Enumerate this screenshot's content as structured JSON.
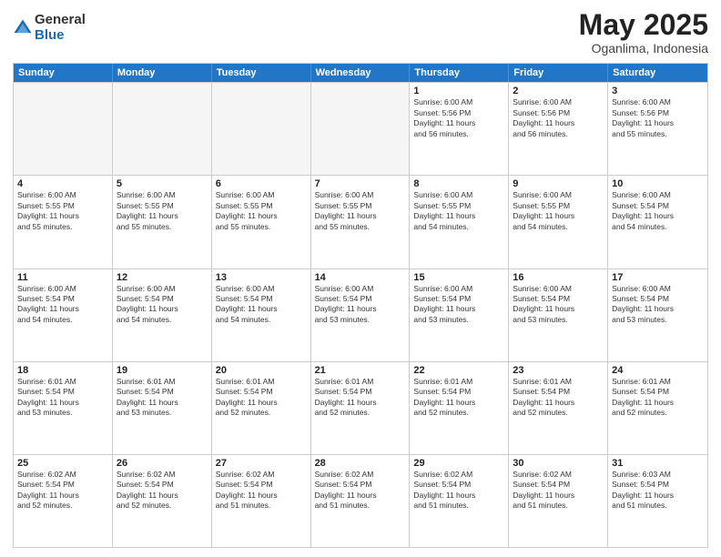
{
  "logo": {
    "general": "General",
    "blue": "Blue"
  },
  "title": "May 2025",
  "location": "Oganlima, Indonesia",
  "header_days": [
    "Sunday",
    "Monday",
    "Tuesday",
    "Wednesday",
    "Thursday",
    "Friday",
    "Saturday"
  ],
  "rows": [
    [
      {
        "day": "",
        "text": "",
        "empty": true
      },
      {
        "day": "",
        "text": "",
        "empty": true
      },
      {
        "day": "",
        "text": "",
        "empty": true
      },
      {
        "day": "",
        "text": "",
        "empty": true
      },
      {
        "day": "1",
        "text": "Sunrise: 6:00 AM\nSunset: 5:56 PM\nDaylight: 11 hours\nand 56 minutes."
      },
      {
        "day": "2",
        "text": "Sunrise: 6:00 AM\nSunset: 5:56 PM\nDaylight: 11 hours\nand 56 minutes."
      },
      {
        "day": "3",
        "text": "Sunrise: 6:00 AM\nSunset: 5:56 PM\nDaylight: 11 hours\nand 55 minutes."
      }
    ],
    [
      {
        "day": "4",
        "text": "Sunrise: 6:00 AM\nSunset: 5:55 PM\nDaylight: 11 hours\nand 55 minutes."
      },
      {
        "day": "5",
        "text": "Sunrise: 6:00 AM\nSunset: 5:55 PM\nDaylight: 11 hours\nand 55 minutes."
      },
      {
        "day": "6",
        "text": "Sunrise: 6:00 AM\nSunset: 5:55 PM\nDaylight: 11 hours\nand 55 minutes."
      },
      {
        "day": "7",
        "text": "Sunrise: 6:00 AM\nSunset: 5:55 PM\nDaylight: 11 hours\nand 55 minutes."
      },
      {
        "day": "8",
        "text": "Sunrise: 6:00 AM\nSunset: 5:55 PM\nDaylight: 11 hours\nand 54 minutes."
      },
      {
        "day": "9",
        "text": "Sunrise: 6:00 AM\nSunset: 5:55 PM\nDaylight: 11 hours\nand 54 minutes."
      },
      {
        "day": "10",
        "text": "Sunrise: 6:00 AM\nSunset: 5:54 PM\nDaylight: 11 hours\nand 54 minutes."
      }
    ],
    [
      {
        "day": "11",
        "text": "Sunrise: 6:00 AM\nSunset: 5:54 PM\nDaylight: 11 hours\nand 54 minutes."
      },
      {
        "day": "12",
        "text": "Sunrise: 6:00 AM\nSunset: 5:54 PM\nDaylight: 11 hours\nand 54 minutes."
      },
      {
        "day": "13",
        "text": "Sunrise: 6:00 AM\nSunset: 5:54 PM\nDaylight: 11 hours\nand 54 minutes."
      },
      {
        "day": "14",
        "text": "Sunrise: 6:00 AM\nSunset: 5:54 PM\nDaylight: 11 hours\nand 53 minutes."
      },
      {
        "day": "15",
        "text": "Sunrise: 6:00 AM\nSunset: 5:54 PM\nDaylight: 11 hours\nand 53 minutes."
      },
      {
        "day": "16",
        "text": "Sunrise: 6:00 AM\nSunset: 5:54 PM\nDaylight: 11 hours\nand 53 minutes."
      },
      {
        "day": "17",
        "text": "Sunrise: 6:00 AM\nSunset: 5:54 PM\nDaylight: 11 hours\nand 53 minutes."
      }
    ],
    [
      {
        "day": "18",
        "text": "Sunrise: 6:01 AM\nSunset: 5:54 PM\nDaylight: 11 hours\nand 53 minutes."
      },
      {
        "day": "19",
        "text": "Sunrise: 6:01 AM\nSunset: 5:54 PM\nDaylight: 11 hours\nand 53 minutes."
      },
      {
        "day": "20",
        "text": "Sunrise: 6:01 AM\nSunset: 5:54 PM\nDaylight: 11 hours\nand 52 minutes."
      },
      {
        "day": "21",
        "text": "Sunrise: 6:01 AM\nSunset: 5:54 PM\nDaylight: 11 hours\nand 52 minutes."
      },
      {
        "day": "22",
        "text": "Sunrise: 6:01 AM\nSunset: 5:54 PM\nDaylight: 11 hours\nand 52 minutes."
      },
      {
        "day": "23",
        "text": "Sunrise: 6:01 AM\nSunset: 5:54 PM\nDaylight: 11 hours\nand 52 minutes."
      },
      {
        "day": "24",
        "text": "Sunrise: 6:01 AM\nSunset: 5:54 PM\nDaylight: 11 hours\nand 52 minutes."
      }
    ],
    [
      {
        "day": "25",
        "text": "Sunrise: 6:02 AM\nSunset: 5:54 PM\nDaylight: 11 hours\nand 52 minutes."
      },
      {
        "day": "26",
        "text": "Sunrise: 6:02 AM\nSunset: 5:54 PM\nDaylight: 11 hours\nand 52 minutes."
      },
      {
        "day": "27",
        "text": "Sunrise: 6:02 AM\nSunset: 5:54 PM\nDaylight: 11 hours\nand 51 minutes."
      },
      {
        "day": "28",
        "text": "Sunrise: 6:02 AM\nSunset: 5:54 PM\nDaylight: 11 hours\nand 51 minutes."
      },
      {
        "day": "29",
        "text": "Sunrise: 6:02 AM\nSunset: 5:54 PM\nDaylight: 11 hours\nand 51 minutes."
      },
      {
        "day": "30",
        "text": "Sunrise: 6:02 AM\nSunset: 5:54 PM\nDaylight: 11 hours\nand 51 minutes."
      },
      {
        "day": "31",
        "text": "Sunrise: 6:03 AM\nSunset: 5:54 PM\nDaylight: 11 hours\nand 51 minutes."
      }
    ]
  ]
}
